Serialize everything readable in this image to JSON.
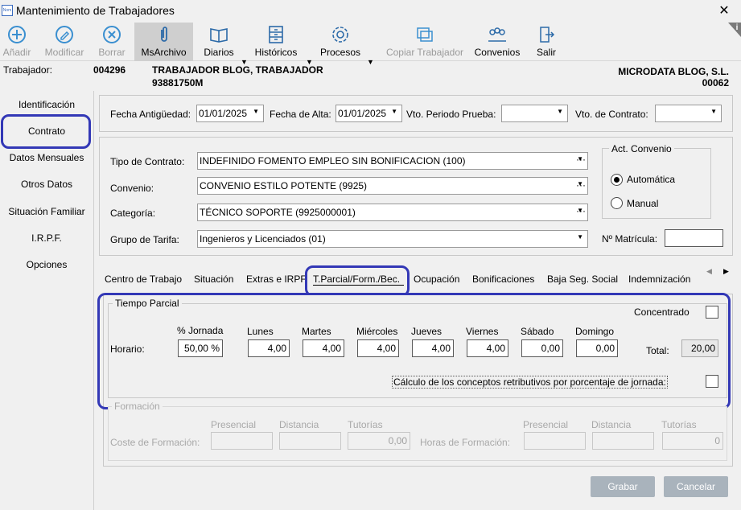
{
  "window": {
    "title": "Mantenimiento de Trabajadores",
    "app_icon_text": "Nom"
  },
  "toolbar": {
    "anadir": "Añadir",
    "modificar": "Modificar",
    "borrar": "Borrar",
    "msarchivo": "MsArchivo",
    "diarios": "Diarios",
    "historicos": "Históricos",
    "procesos": "Procesos",
    "copiar": "Copiar Trabajador",
    "convenios": "Convenios",
    "salir": "Salir",
    "info": "i"
  },
  "header": {
    "trabajador_label": "Trabajador:",
    "codigo": "004296",
    "nombre": "TRABAJADOR BLOG, TRABAJADOR",
    "dni": "93881750M",
    "empresa": "MICRODATA BLOG, S.L.",
    "empresa_codigo": "00062"
  },
  "sidebar": [
    "Identificación",
    "Contrato",
    "Datos Mensuales",
    "Otros Datos",
    "Situación Familiar",
    "I.R.P.F.",
    "Opciones"
  ],
  "fechas": {
    "antiguedad_label": "Fecha Antigüedad:",
    "antiguedad": "01/01/2025",
    "alta_label": "Fecha de Alta:",
    "alta": "01/01/2025",
    "prueba_label": "Vto. Periodo Prueba:",
    "contrato_label": "Vto. de Contrato:"
  },
  "contrato": {
    "tipo_label": "Tipo de Contrato:",
    "tipo": "INDEFINIDO FOMENTO EMPLEO SIN BONIFICACION (100)",
    "convenio_label": "Convenio:",
    "convenio": "CONVENIO ESTILO POTENTE (9925)",
    "categoria_label": "Categoría:",
    "categoria": "TÉCNICO SOPORTE (9925000001)",
    "grupo_label": "Grupo de Tarifa:",
    "grupo": "Ingenieros y Licenciados (01)",
    "act_convenio": "Act. Convenio",
    "automatica": "Automática",
    "manual": "Manual",
    "matricula_label": "Nº Matrícula:"
  },
  "tabs": [
    "Centro de Trabajo",
    "Situación",
    "Extras e IRPF",
    "T.Parcial/Form./Bec.",
    "Ocupación",
    "Bonificaciones",
    "Baja Seg. Social",
    "Indemnización"
  ],
  "tiempo_parcial": {
    "title": "Tiempo Parcial",
    "concentrado": "Concentrado",
    "horario": "Horario:",
    "jornada_label": "% Jornada",
    "jornada": "50,00 %",
    "dias": [
      {
        "label": "Lunes",
        "value": "4,00"
      },
      {
        "label": "Martes",
        "value": "4,00"
      },
      {
        "label": "Miércoles",
        "value": "4,00"
      },
      {
        "label": "Jueves",
        "value": "4,00"
      },
      {
        "label": "Viernes",
        "value": "4,00"
      },
      {
        "label": "Sábado",
        "value": "0,00"
      },
      {
        "label": "Domingo",
        "value": "0,00"
      }
    ],
    "total_label": "Total:",
    "total": "20,00",
    "calculo": "Cálculo de los conceptos retributivos por porcentaje de jornada:"
  },
  "formacion": {
    "title": "Formación",
    "presencial": "Presencial",
    "distancia": "Distancia",
    "tutorias": "Tutorías",
    "coste_label": "Coste de Formación:",
    "coste_tutorias": "0,00",
    "horas_label": "Horas de Formación:",
    "horas_tutorias": "0"
  },
  "buttons": {
    "grabar": "Grabar",
    "cancelar": "Cancelar"
  }
}
